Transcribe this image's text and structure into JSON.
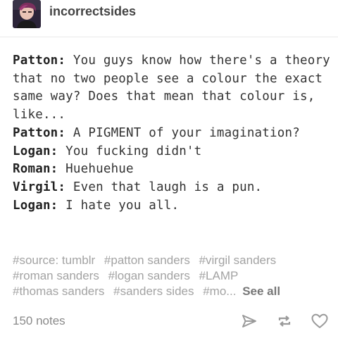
{
  "post": {
    "blog_name": "incorrectsides",
    "dialogue": [
      {
        "speaker": "Patton:",
        "text": " You guys know how there's a theory that no two people see a colour the exact same way? Does that mean that colour is, like..."
      },
      {
        "speaker": "Patton:",
        "text": " A PIGMENT of your imagination?"
      },
      {
        "speaker": "Logan:",
        "text": " You fucking didn't"
      },
      {
        "speaker": "Roman:",
        "text": " Huehuehue"
      },
      {
        "speaker": "Virgil:",
        "text": " Even that laugh is a pun."
      },
      {
        "speaker": "Logan:",
        "text": " I hate you all."
      }
    ],
    "tags": [
      "#source: tumblr",
      "#patton sanders",
      "#virgil sanders",
      "#roman sanders",
      "#logan sanders",
      "#LAMP",
      "#thomas sanders",
      "#sanders sides",
      "#mo..."
    ],
    "see_all_label": "See all",
    "notes_label": "150 notes"
  },
  "icons": {
    "share": "paper-plane-icon",
    "reblog": "reblog-icon",
    "like": "heart-icon"
  },
  "colors": {
    "text": "#333333",
    "tags": "#a3a3a3",
    "notes": "#8a8a8a",
    "icons": "#9a9a9a"
  }
}
